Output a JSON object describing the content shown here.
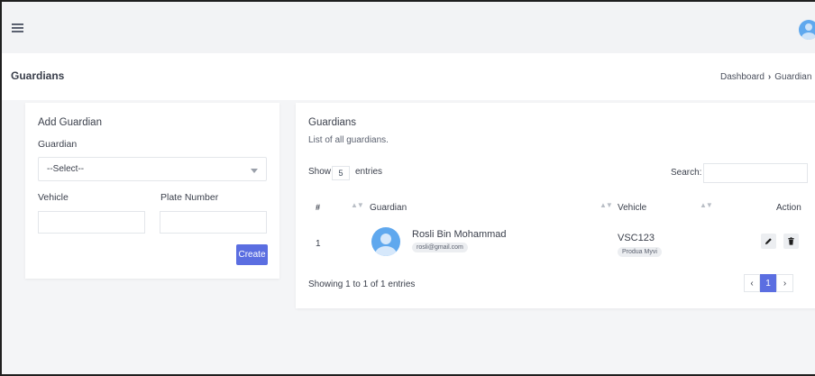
{
  "header": {
    "menu_icon": "hamburger-icon",
    "avatar_icon": "user-avatar-icon"
  },
  "page": {
    "title": "Guardians",
    "breadcrumb": [
      "Dashboard",
      "Guardian"
    ]
  },
  "add_form": {
    "title": "Add Guardian",
    "guardian_label": "Guardian",
    "guardian_select_value": "--Select--",
    "vehicle_label": "Vehicle",
    "vehicle_value": "",
    "plate_label": "Plate Number",
    "plate_value": "",
    "create_label": "Create"
  },
  "list": {
    "title": "Guardians",
    "subtitle": "List of all guardians.",
    "show_label": "Show",
    "show_value": "5",
    "entries_label": "entries",
    "search_label": "Search:",
    "search_value": "",
    "columns": [
      "#",
      "Guardian",
      "Vehicle",
      "Action"
    ],
    "rows": [
      {
        "index": "1",
        "name": "Rosli Bin Mohammad",
        "email": "rosli@gmail.com",
        "plate": "VSC123",
        "model": "Produa Myvi"
      }
    ],
    "info": "Showing 1 to 1 of 1 entries",
    "pagination": {
      "prev": "‹",
      "current": "1",
      "next": "›"
    }
  },
  "colors": {
    "accent": "#5b6ee1",
    "avatar": "#5fa8ee",
    "background": "#f4f5f7"
  }
}
